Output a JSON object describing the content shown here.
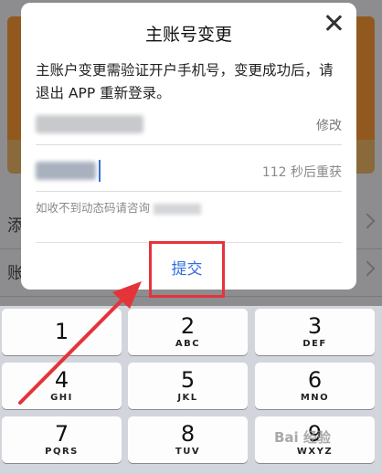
{
  "background": {
    "rows": [
      {
        "label": "添"
      },
      {
        "label": "账"
      }
    ]
  },
  "dialog": {
    "title": "主账号变更",
    "description": "主账户变更需验证开户手机号，变更成功后，请退出 APP 重新登录。",
    "phone_field": {
      "action": "修改"
    },
    "code_field": {
      "countdown": "112 秒后重获"
    },
    "help_text": "如收不到动态码请咨询",
    "submit_label": "提交"
  },
  "keyboard": {
    "keys": [
      {
        "num": "1",
        "letters": ""
      },
      {
        "num": "2",
        "letters": "ABC"
      },
      {
        "num": "3",
        "letters": "DEF"
      },
      {
        "num": "4",
        "letters": "GHI"
      },
      {
        "num": "5",
        "letters": "JKL"
      },
      {
        "num": "6",
        "letters": "MNO"
      },
      {
        "num": "7",
        "letters": "PQRS"
      },
      {
        "num": "8",
        "letters": "TUV"
      },
      {
        "num": "9",
        "letters": "WXYZ"
      }
    ]
  },
  "watermark": "Bai 经验",
  "colors": {
    "accent": "#2f6fe0",
    "highlight": "#e5333a",
    "dim_overlay": "#8d8d8f",
    "keyboard_bg": "#d2d5db"
  }
}
